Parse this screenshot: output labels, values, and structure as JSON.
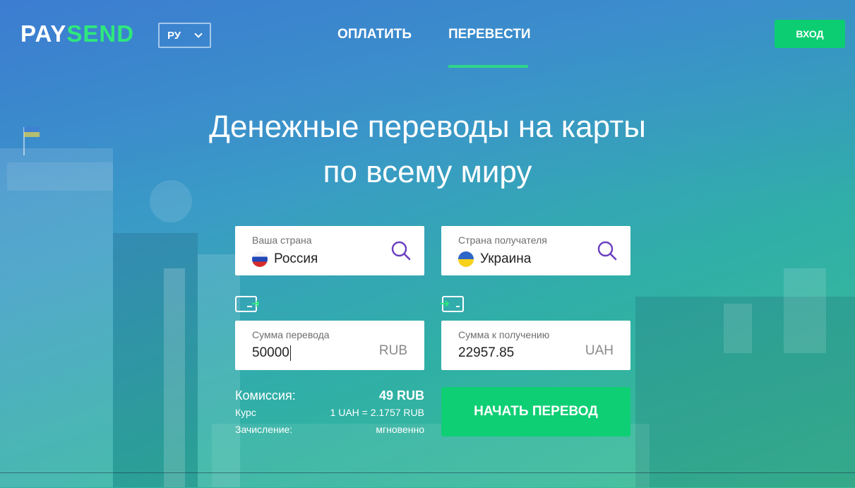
{
  "brand": {
    "logo_part1": "PAY",
    "logo_part2": "SEND"
  },
  "header": {
    "language": "РУ",
    "nav": {
      "pay": "ОПЛАТИТЬ",
      "send": "ПЕРЕВЕСТИ"
    },
    "login": "ВХОД"
  },
  "hero": {
    "title_line1": "Денежные переводы на карты",
    "title_line2": "по всему миру"
  },
  "form": {
    "from_country": {
      "label": "Ваша страна",
      "value": "Россия",
      "flag": "flag-russia"
    },
    "to_country": {
      "label": "Страна получателя",
      "value": "Украина",
      "flag": "flag-ukraine"
    },
    "send_amount": {
      "label": "Сумма перевода",
      "value": "50000",
      "currency": "RUB"
    },
    "receive_amount": {
      "label": "Сумма к получению",
      "value": "22957.85",
      "currency": "UAH"
    }
  },
  "summary": {
    "fee_label": "Комиссия:",
    "fee_value": "49 RUB",
    "rate_label": "Курс",
    "rate_value": "1 UAH = 2.1757 RUB",
    "credit_label": "Зачисление:",
    "credit_value": "мгновенно"
  },
  "actions": {
    "start": "НАЧАТЬ ПЕРЕВОД"
  },
  "colors": {
    "accent_green": "#0fcf74",
    "logo_green": "#2ee87d",
    "search_icon": "#6a3fc0",
    "nav_underline": "#2fd58a"
  }
}
